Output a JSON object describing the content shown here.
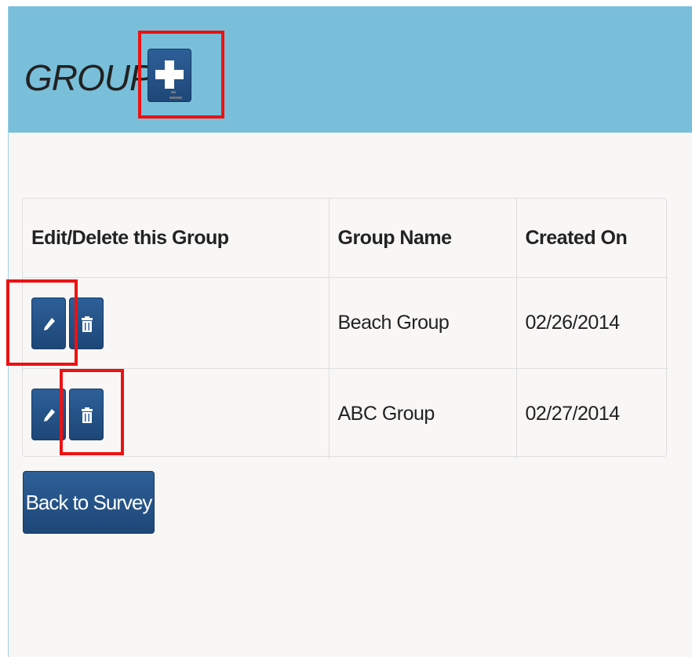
{
  "header": {
    "title": "GROUPS"
  },
  "table": {
    "columns": [
      "Edit/Delete this Group",
      "Group Name",
      "Created On"
    ],
    "rows": [
      {
        "group_name": "Beach Group",
        "created_on": "02/26/2014"
      },
      {
        "group_name": "ABC Group",
        "created_on": "02/27/2014"
      }
    ]
  },
  "footer": {
    "back_label": "Back to Survey"
  },
  "icons": {
    "add": "plus-icon",
    "edit": "pencil-icon",
    "delete": "trash-icon"
  },
  "colors": {
    "header_bg": "#79bfda",
    "button_bg": "#2d5f98",
    "highlight": "#ee1111",
    "page_bg": "#f8f7f6"
  }
}
